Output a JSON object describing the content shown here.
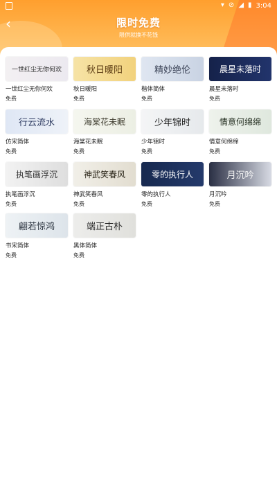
{
  "status": {
    "time": "3:04",
    "battery": "▮",
    "wifi": "▾",
    "signal": "◢",
    "silent": "⊘"
  },
  "header": {
    "back": "‹",
    "title": "限时免费",
    "subtitle": "限供就换不花钱"
  },
  "colors": {
    "header_orange": "#ffa536",
    "card_bg": "#ffffff"
  },
  "fonts": [
    {
      "preview": "一世红尘无你何欢",
      "name": "一世红尘无你何欢",
      "price": "免费",
      "bg": "linear-gradient(90deg,#f3f0f2,#ece9f0)",
      "fg": "#2b2b2b"
    },
    {
      "preview": "秋日暖阳",
      "name": "秋日暖阳",
      "price": "免费",
      "bg": "linear-gradient(90deg,#f6e3a6,#f2d27d)",
      "fg": "#5a3a12"
    },
    {
      "preview": "精妙绝伦",
      "name": "楷体简体",
      "price": "免费",
      "bg": "linear-gradient(90deg,#dfe6f1,#c9d3e3)",
      "fg": "#3a4256"
    },
    {
      "preview": "晨星未落时",
      "name": "晨星未落时",
      "price": "免费",
      "bg": "linear-gradient(90deg,#15224a,#22346c)",
      "fg": "#ffffff"
    },
    {
      "preview": "行云流水",
      "name": "仿宋简体",
      "price": "免费",
      "bg": "linear-gradient(90deg,#dfe7f5,#eef2f8)",
      "fg": "#2f3c62"
    },
    {
      "preview": "海棠花未眠",
      "name": "海棠花未眠",
      "price": "免费",
      "bg": "linear-gradient(90deg,#f5f6ef,#ecefe4)",
      "fg": "#3c3a2c"
    },
    {
      "preview": "少年锦时",
      "name": "少年锦时",
      "price": "免费",
      "bg": "linear-gradient(90deg,#f4f5f6,#e6e9ec)",
      "fg": "#1f1f1f"
    },
    {
      "preview": "情意何绵绵",
      "name": "情意何绵绵",
      "price": "免费",
      "bg": "linear-gradient(90deg,#eef2ec,#dfe8de)",
      "fg": "#1f2a1c"
    },
    {
      "preview": "执笔画浮沉",
      "name": "执笔画浮沉",
      "price": "免费",
      "bg": "linear-gradient(90deg,#f2f2f2,#dedede)",
      "fg": "#333333"
    },
    {
      "preview": "神武笑春风",
      "name": "神武笑春风",
      "price": "免费",
      "bg": "linear-gradient(90deg,#f1efe8,#e2ddd0)",
      "fg": "#2a2518"
    },
    {
      "preview": "零的执行人",
      "name": "零的执行人",
      "price": "免费",
      "bg": "linear-gradient(90deg,#17294f,#243a6b)",
      "fg": "#ffffff"
    },
    {
      "preview": "月沉吟",
      "name": "月沉吟",
      "price": "免费",
      "bg": "linear-gradient(90deg,#2a2f44,#d8dbe4)",
      "fg": "#f5f5f5"
    },
    {
      "preview": "翩若惊鸿",
      "name": "书宋简体",
      "price": "免费",
      "bg": "linear-gradient(90deg,#eef2f5,#dde4ea)",
      "fg": "#2c3440"
    },
    {
      "preview": "端正古朴",
      "name": "黑体简体",
      "price": "免费",
      "bg": "linear-gradient(90deg,#ededeb,#e0e0dc)",
      "fg": "#2a2a2a"
    }
  ]
}
